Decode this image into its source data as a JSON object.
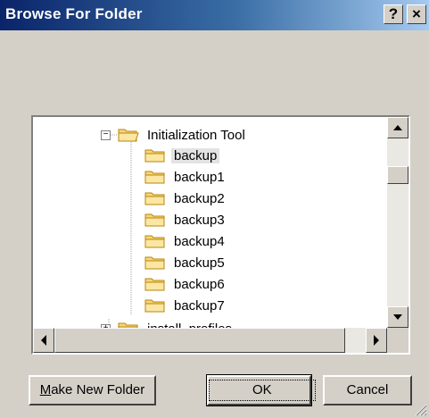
{
  "window": {
    "title": "Browse For Folder",
    "help_label": "?",
    "close_label": "×"
  },
  "tree": {
    "parent": {
      "label": "Initialization Tool",
      "expander": "−"
    },
    "children": [
      "backup",
      "backup1",
      "backup2",
      "backup3",
      "backup4",
      "backup5",
      "backup6",
      "backup7"
    ],
    "selected_index": 0,
    "partial_next": {
      "label": "install_profiles",
      "expander": "+"
    }
  },
  "buttons": {
    "make_new_folder_prefix": "M",
    "make_new_folder_rest": "ake New Folder",
    "ok": "OK",
    "cancel": "Cancel"
  },
  "colors": {
    "titlebar_start": "#0a246a",
    "titlebar_end": "#a6caf0",
    "folder_fill": "#f6d67a",
    "folder_stroke": "#b8860b"
  }
}
